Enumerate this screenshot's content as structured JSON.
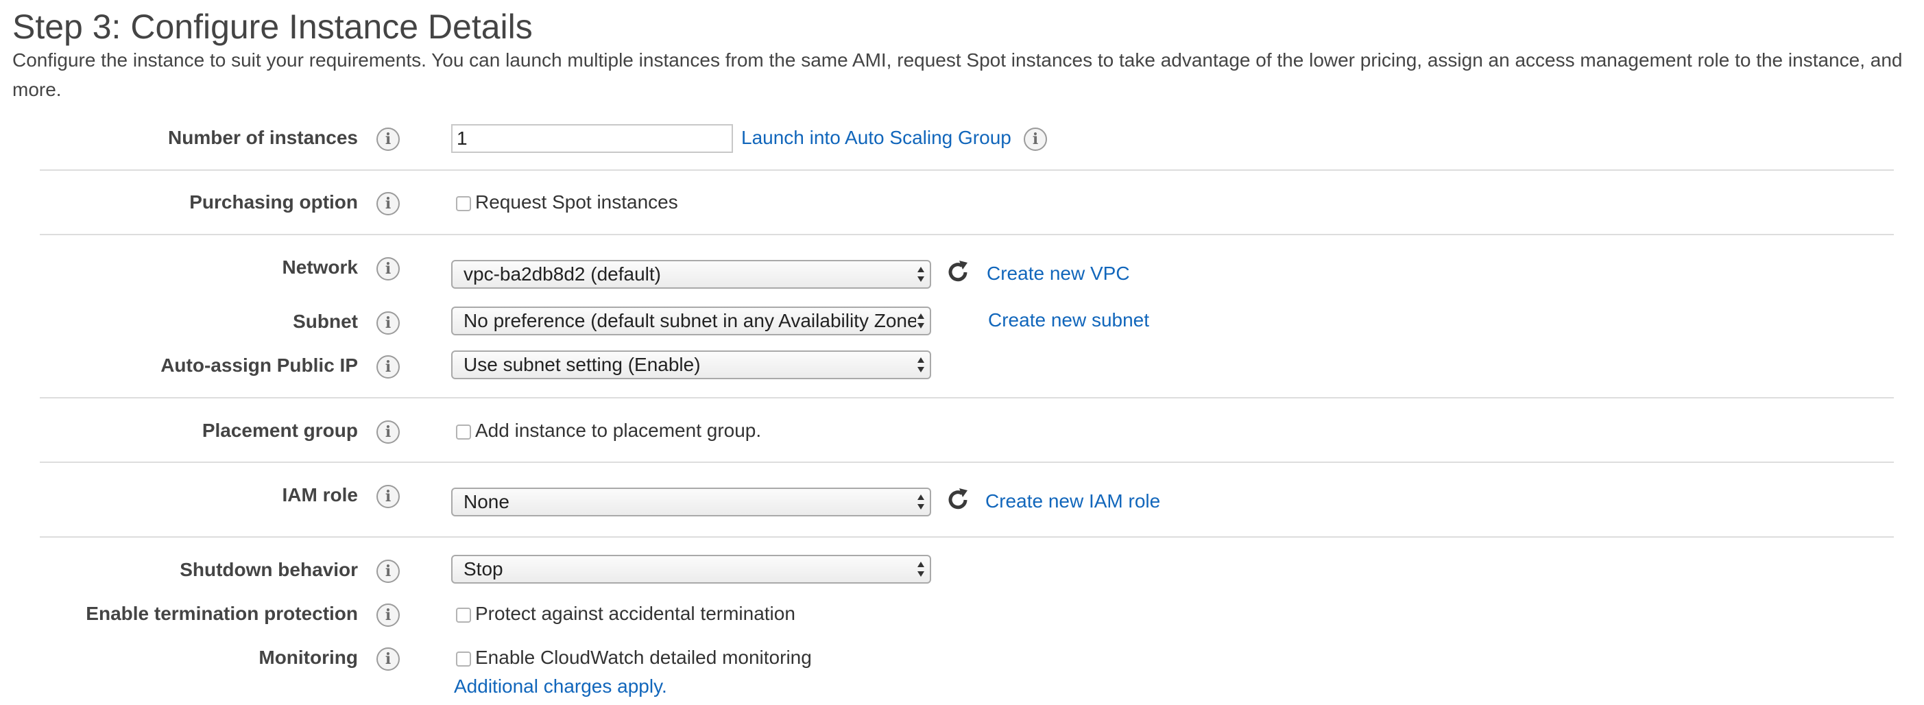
{
  "page": {
    "title": "Step 3: Configure Instance Details",
    "description": "Configure the instance to suit your requirements. You can launch multiple instances from the same AMI, request Spot instances to take advantage of the lower pricing, assign an access management role to the instance, and more."
  },
  "info_icon_glyph": "i",
  "rows": {
    "instances": {
      "label": "Number of instances",
      "value": "1",
      "link": "Launch into Auto Scaling Group"
    },
    "purchasing": {
      "label": "Purchasing option",
      "checkbox_label": "Request Spot instances",
      "checked": false
    },
    "network": {
      "label": "Network",
      "selected": "vpc-ba2db8d2 (default)",
      "link": "Create new VPC",
      "refresh_icon": "refresh-icon"
    },
    "subnet": {
      "label": "Subnet",
      "selected": "No preference (default subnet in any Availability Zone)",
      "link": "Create new subnet"
    },
    "public_ip": {
      "label": "Auto-assign Public IP",
      "selected": "Use subnet setting (Enable)"
    },
    "placement": {
      "label": "Placement group",
      "checkbox_label": "Add instance to placement group.",
      "checked": false
    },
    "iam": {
      "label": "IAM role",
      "selected": "None",
      "link": "Create new IAM role",
      "refresh_icon": "refresh-icon"
    },
    "shutdown": {
      "label": "Shutdown behavior",
      "selected": "Stop"
    },
    "termination": {
      "label": "Enable termination protection",
      "checkbox_label": "Protect against accidental termination",
      "checked": false
    },
    "monitoring": {
      "label": "Monitoring",
      "checkbox_label": "Enable CloudWatch detailed monitoring",
      "checked": false,
      "link": "Additional charges apply."
    }
  },
  "colors": {
    "link": "#1166bb",
    "label": "#444444",
    "divider": "#dddddd"
  }
}
